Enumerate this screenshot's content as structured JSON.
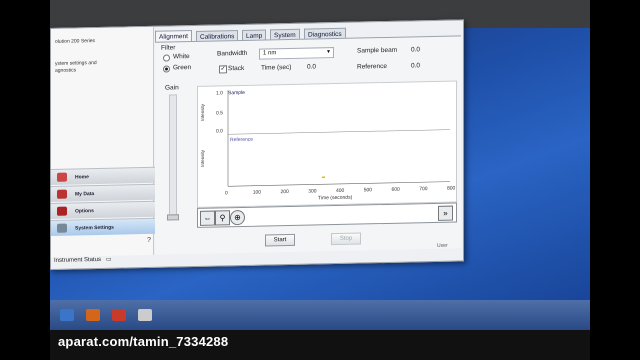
{
  "app": {
    "title": "olution 200 Series",
    "subtitle_lines": [
      "ystem settings and",
      "agnostics"
    ]
  },
  "nav": [
    {
      "label": "Home",
      "icon": "home-icon"
    },
    {
      "label": "My Data",
      "icon": "folder-icon"
    },
    {
      "label": "Options",
      "icon": "wrench-icon"
    },
    {
      "label": "System Settings",
      "icon": "gear-icon"
    }
  ],
  "help_label": "?",
  "status_label": "Instrument Status",
  "tabs": [
    "Alignment",
    "Calibrations",
    "Lamp",
    "System",
    "Diagnostics"
  ],
  "filter": {
    "group_label": "Filter",
    "options": [
      "White",
      "Green"
    ],
    "selected": "Green"
  },
  "bandwidth": {
    "label": "Bandwidth",
    "value": "1 nm"
  },
  "stack": {
    "label": "Stack",
    "checked": true,
    "check_glyph": "✓"
  },
  "time": {
    "label": "Time (sec)",
    "value": "0.0"
  },
  "sample_beam": {
    "label": "Sample beam",
    "value": "0.0"
  },
  "reference": {
    "label": "Reference",
    "value": "0.0"
  },
  "gain": {
    "label": "Gain"
  },
  "plot": {
    "upper_title": "Sample",
    "lower_title": "Reference",
    "ylabel": "Intensity",
    "xlabel": "Time (seconds)",
    "y_ticks": [
      "1.0",
      "0.5",
      "0.0"
    ],
    "x_ticks": [
      "0",
      "100",
      "200",
      "300",
      "400",
      "500",
      "600",
      "700",
      "800"
    ]
  },
  "toolbar": {
    "icons": [
      "fit-icon",
      "zoom-icon",
      "crosshair-icon"
    ],
    "right_icon": "scroll-icon"
  },
  "start_label": "Start",
  "stop_label": "Stop",
  "user_label": "User",
  "watermark": "aparat.com/tamin_7334288"
}
